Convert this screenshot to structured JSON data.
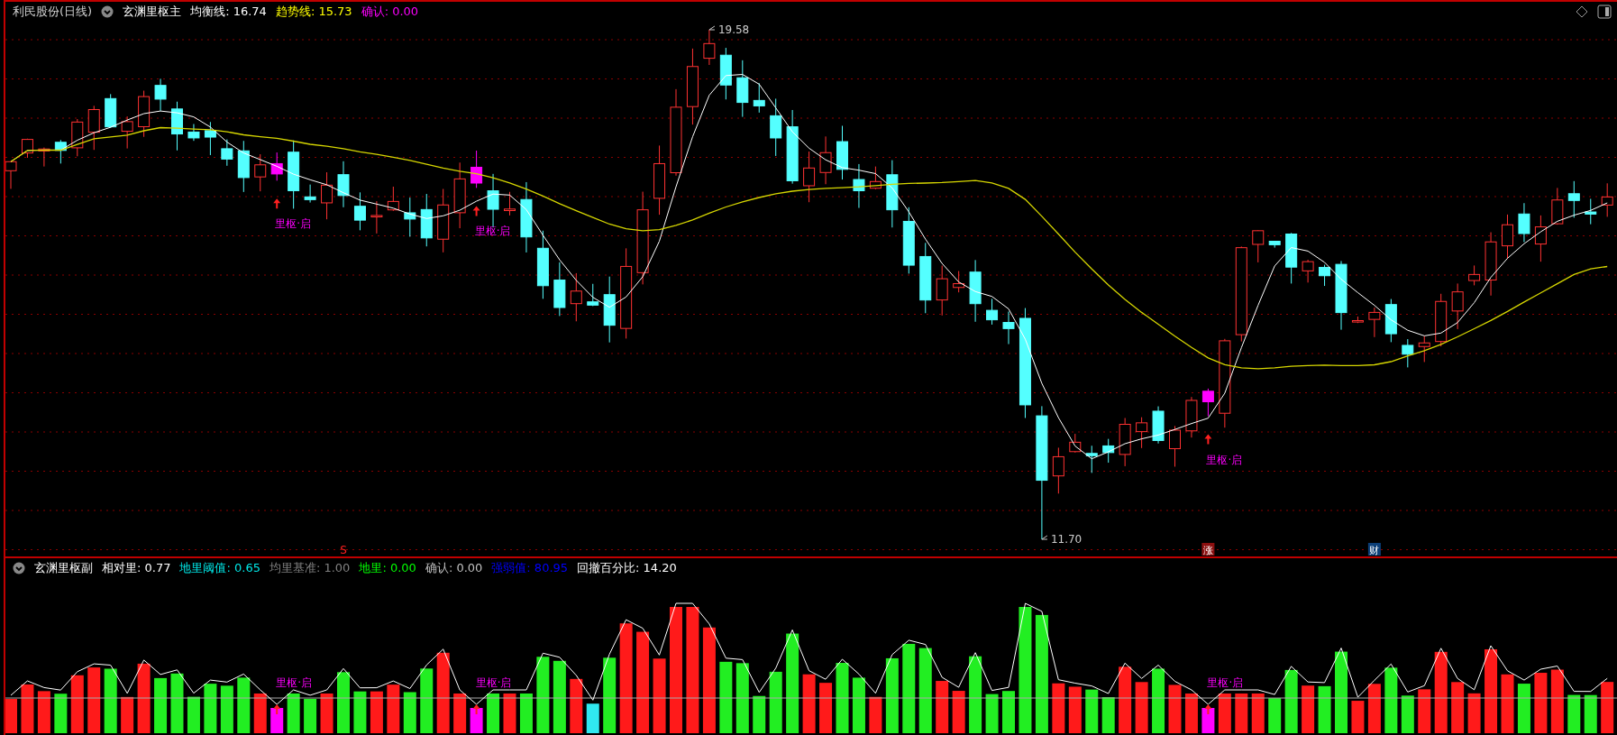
{
  "main_panel": {
    "title": "利民股份(日线)",
    "indicator": "玄渊里枢主",
    "readings": [
      {
        "text": "均衡线: 16.74",
        "color": "#ffffff"
      },
      {
        "text": "趋势线: 15.73",
        "color": "#ffff00"
      },
      {
        "text": "确认: 0.00",
        "color": "#ff00ff"
      }
    ],
    "high_label": "19.58",
    "low_label": "11.70",
    "signals": [
      {
        "label": "里枢·启"
      },
      {
        "label": "里枢·启"
      },
      {
        "label": "里枢·启"
      }
    ],
    "markers": [
      {
        "text": "S",
        "kind": "letter"
      },
      {
        "text": "涨",
        "kind": "badge",
        "color": "#8b0f0f"
      },
      {
        "text": "财",
        "kind": "badge",
        "color": "#0c3f78"
      }
    ]
  },
  "sub_panel": {
    "indicator": "玄渊里枢副",
    "readings": [
      {
        "text": "相对里: 0.77",
        "color": "#ffffff"
      },
      {
        "text": "地里阈值: 0.65",
        "color": "#00e8e8"
      },
      {
        "text": "均里基准: 1.00",
        "color": "#808080"
      },
      {
        "text": "地里: 0.00",
        "color": "#00ff00"
      },
      {
        "text": "确认: 0.00",
        "color": "#c0c0c0"
      },
      {
        "text": "强弱值: 80.95",
        "color": "#0000ff"
      },
      {
        "text": "回撤百分比: 14.20",
        "color": "#ffffff"
      }
    ],
    "signals": [
      {
        "label": "里枢·启"
      },
      {
        "label": "里枢·启"
      },
      {
        "label": "里枢·启"
      }
    ]
  }
}
